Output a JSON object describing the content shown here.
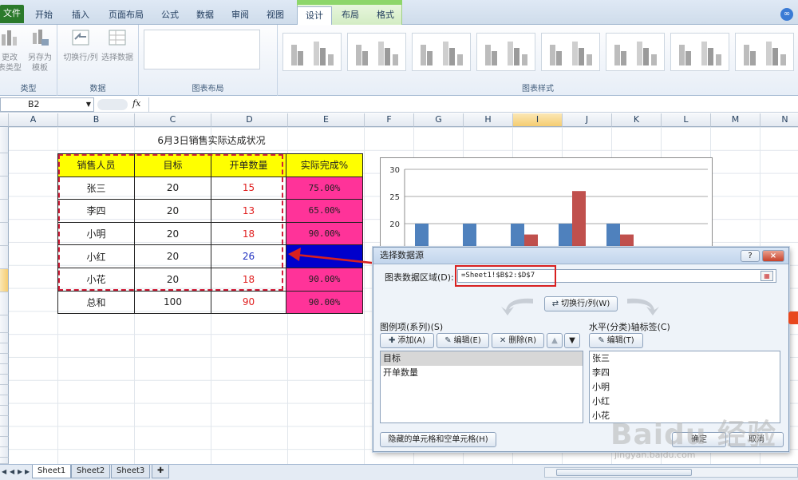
{
  "ribbon": {
    "tabs": [
      "文件",
      "开始",
      "插入",
      "页面布局",
      "公式",
      "数据",
      "审阅",
      "视图",
      "设计",
      "布局",
      "格式"
    ],
    "active_tab": "设计",
    "groups": {
      "type": {
        "label": "类型",
        "change_type": "更改\n表类型",
        "save_template": "另存为\n模板"
      },
      "data": {
        "label": "数据",
        "switch": "切换行/列",
        "select_data": "选择数据"
      },
      "layout": {
        "label": "图表布局"
      },
      "styles": {
        "label": "图表样式"
      }
    }
  },
  "formula_bar": {
    "name_box": "B2",
    "fx": "fx",
    "formula": ""
  },
  "columns": [
    "A",
    "B",
    "C",
    "D",
    "E",
    "F",
    "G",
    "H",
    "I",
    "J",
    "K",
    "L",
    "M",
    "N"
  ],
  "sheet": {
    "title": "6月3日销售实际达成状况",
    "headers": [
      "销售人员",
      "目标",
      "开单数量",
      "实际完成%"
    ],
    "rows": [
      {
        "name": "张三",
        "target": "20",
        "count": "15",
        "pct": "75.00%"
      },
      {
        "name": "李四",
        "target": "20",
        "count": "13",
        "pct": "65.00%"
      },
      {
        "name": "小明",
        "target": "20",
        "count": "18",
        "pct": "90.00%"
      },
      {
        "name": "小红",
        "target": "20",
        "count": "26",
        "pct": ""
      },
      {
        "name": "小花",
        "target": "20",
        "count": "18",
        "pct": "90.00%"
      },
      {
        "name": "总和",
        "target": "100",
        "count": "90",
        "pct": "90.00%"
      }
    ]
  },
  "chart_data": {
    "type": "bar",
    "categories": [
      "张三",
      "李四",
      "小明",
      "小红",
      "小花"
    ],
    "series": [
      {
        "name": "目标",
        "values": [
          20,
          20,
          20,
          20,
          20
        ],
        "color": "#4f81bd"
      },
      {
        "name": "开单数量",
        "values": [
          15,
          13,
          18,
          26,
          18
        ],
        "color": "#c0504d"
      }
    ],
    "yticks": [
      20,
      25,
      30
    ],
    "ylim": [
      0,
      30
    ],
    "title": "",
    "xlabel": "",
    "ylabel": ""
  },
  "dialog": {
    "title": "选择数据源",
    "help": "?",
    "close": "×",
    "range_label": "图表数据区域(D):",
    "range_value": "=Sheet1!$B$2:$D$7",
    "switch_button": "切换行/列(W)",
    "legend_label": "图例项(系列)(S)",
    "add": "添加(A)",
    "edit": "编辑(E)",
    "delete": "删除(R)",
    "axis_label": "水平(分类)轴标签(C)",
    "axis_edit": "编辑(T)",
    "series_items": [
      "目标",
      "开单数量"
    ],
    "axis_items": [
      "张三",
      "李四",
      "小明",
      "小红",
      "小花"
    ],
    "hidden_cells": "隐藏的单元格和空单元格(H)",
    "ok": "确定",
    "cancel": "取消"
  },
  "sheet_tabs": [
    "Sheet1",
    "Sheet2",
    "Sheet3"
  ],
  "watermark": {
    "main": "Baidu 经验",
    "sub": "jingyan.baidu.com"
  }
}
